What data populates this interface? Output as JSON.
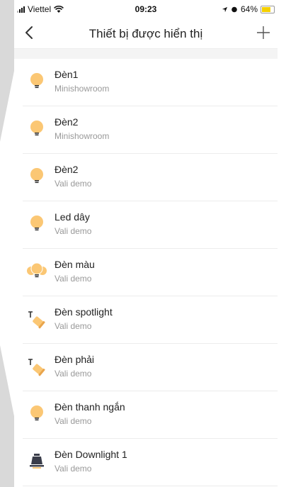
{
  "status": {
    "carrier": "Viettel",
    "time": "09:23",
    "battery": "64%",
    "battery_level": 0.64
  },
  "nav": {
    "title": "Thiết bị được hiển thị"
  },
  "devices": [
    {
      "name": "Đèn1",
      "room": "Minishowroom",
      "icon": "bulb-icon"
    },
    {
      "name": "Đèn2",
      "room": "Minishowroom",
      "icon": "bulb-icon"
    },
    {
      "name": "Đèn2",
      "room": "Vali demo",
      "icon": "bulb-icon"
    },
    {
      "name": "Led dây",
      "room": "Vali demo",
      "icon": "bulb-icon"
    },
    {
      "name": "Đèn màu",
      "room": "Vali demo",
      "icon": "color-bulb-icon"
    },
    {
      "name": "Đèn spotlight",
      "room": "Vali demo",
      "icon": "spotlight-icon"
    },
    {
      "name": "Đèn phải",
      "room": "Vali demo",
      "icon": "spotlight-icon"
    },
    {
      "name": "Đèn thanh ngắn",
      "room": "Vali demo",
      "icon": "bulb-icon"
    },
    {
      "name": "Đèn Downlight 1",
      "room": "Vali demo",
      "icon": "downlight-icon"
    }
  ],
  "colors": {
    "bulb": "#fbc774",
    "bulb_base": "#333333",
    "downlight": "#3a3d4a"
  }
}
